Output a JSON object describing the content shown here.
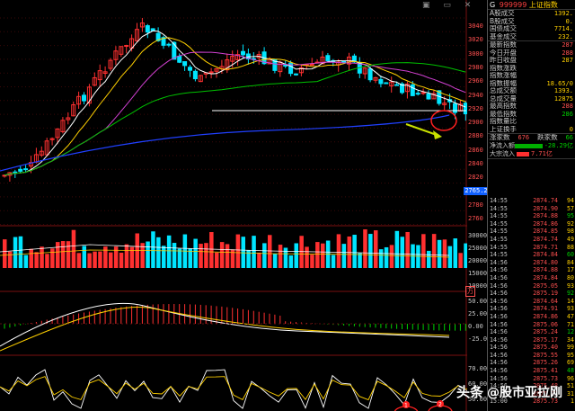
{
  "toolbar": {
    "icons": "▣ ▭ ✕"
  },
  "axis": {
    "price": [
      "3040",
      "3020",
      "3000",
      "2980",
      "2960",
      "2940",
      "2920",
      "2900",
      "2880",
      "2860",
      "2840",
      "2820",
      "2800",
      "2780",
      "2760"
    ],
    "volume": [
      "30000",
      "25000",
      "20000",
      "15000",
      "10000"
    ],
    "volume_unit": "万",
    "macd": [
      "50.00",
      "25.00",
      "0.00",
      "-25.00"
    ],
    "kdj": [
      "70.00",
      "60.00",
      "50.00"
    ],
    "price_tag": "2765.2"
  },
  "panel": {
    "title_icon": "G",
    "title_code": "999999",
    "title_name": "上证指数",
    "rows": [
      {
        "label": "A股成交",
        "value": "1392.",
        "color": "yellow"
      },
      {
        "label": "B股成交",
        "value": "0.",
        "color": "yellow"
      },
      {
        "label": "国债成交",
        "value": "7714.",
        "color": "yellow"
      },
      {
        "label": "基金成交",
        "value": "232.",
        "color": "yellow"
      }
    ],
    "rows2": [
      {
        "label": "最新指数",
        "value": "287",
        "color": "red"
      },
      {
        "label": "今日开盘",
        "value": "288",
        "color": "red"
      },
      {
        "label": "昨日收盘",
        "value": "287",
        "color": "yellow"
      },
      {
        "label": "指数涨跌",
        "value": "",
        "color": "red"
      },
      {
        "label": "指数涨幅",
        "value": "",
        "color": "red"
      },
      {
        "label": "指数振幅",
        "value": "18.65/0",
        "color": "yellow"
      },
      {
        "label": "总成交额",
        "value": "1393.",
        "color": "yellow"
      },
      {
        "label": "总成交量",
        "value": "12875",
        "color": "yellow"
      },
      {
        "label": "最高指数",
        "value": "288",
        "color": "red"
      },
      {
        "label": "最低指数",
        "value": "286",
        "color": "green"
      },
      {
        "label": "指数量比",
        "value": "",
        "color": "yellow"
      },
      {
        "label": "上证换手",
        "value": "0",
        "color": "yellow"
      }
    ],
    "updown": {
      "up_label": "涨家数",
      "up_value": "676",
      "down_label": "跌家数",
      "down_value": "66"
    },
    "flows": [
      {
        "label": "净流入额",
        "value": "-28.29亿",
        "color": "green",
        "bar": 40
      },
      {
        "label": "大宗流入",
        "value": "7.71亿",
        "color": "red",
        "bar": 14
      }
    ],
    "ticks": [
      {
        "t": "14:55",
        "p": "2874.74",
        "q": "94"
      },
      {
        "t": "14:55",
        "p": "2874.90",
        "q": "57"
      },
      {
        "t": "14:55",
        "p": "2874.88",
        "q": "95"
      },
      {
        "t": "14:55",
        "p": "2874.86",
        "q": "92"
      },
      {
        "t": "14:55",
        "p": "2874.85",
        "q": "98"
      },
      {
        "t": "14:55",
        "p": "2874.74",
        "q": "49"
      },
      {
        "t": "14:55",
        "p": "2874.71",
        "q": "88"
      },
      {
        "t": "14:55",
        "p": "2874.84",
        "q": "60"
      },
      {
        "t": "14:56",
        "p": "2874.80",
        "q": "84"
      },
      {
        "t": "14:56",
        "p": "2874.88",
        "q": "17"
      },
      {
        "t": "14:56",
        "p": "2874.84",
        "q": "80"
      },
      {
        "t": "14:56",
        "p": "2875.05",
        "q": "93"
      },
      {
        "t": "14:56",
        "p": "2875.19",
        "q": "92"
      },
      {
        "t": "14:56",
        "p": "2874.64",
        "q": "14"
      },
      {
        "t": "14:56",
        "p": "2874.91",
        "q": "93"
      },
      {
        "t": "14:56",
        "p": "2874.86",
        "q": "47"
      },
      {
        "t": "14:56",
        "p": "2875.06",
        "q": "71"
      },
      {
        "t": "14:56",
        "p": "2875.24",
        "q": "12"
      },
      {
        "t": "14:56",
        "p": "2875.17",
        "q": "34"
      },
      {
        "t": "14:56",
        "p": "2875.40",
        "q": "99"
      },
      {
        "t": "14:56",
        "p": "2875.55",
        "q": "95"
      },
      {
        "t": "14:56",
        "p": "2875.26",
        "q": "69"
      },
      {
        "t": "14:56",
        "p": "2875.41",
        "q": "48"
      },
      {
        "t": "14:56",
        "p": "2875.73",
        "q": "96"
      },
      {
        "t": "14:56",
        "p": "2875.48",
        "q": "51"
      },
      {
        "t": "14:56",
        "p": "2875.37",
        "q": "31"
      },
      {
        "t": "15:00",
        "p": "2875.73",
        "q": "1"
      }
    ]
  },
  "annotations": {
    "circle1": "1",
    "circle2": "2"
  },
  "watermark": {
    "logo": "头条",
    "text": "@股市亚拉刚"
  }
}
